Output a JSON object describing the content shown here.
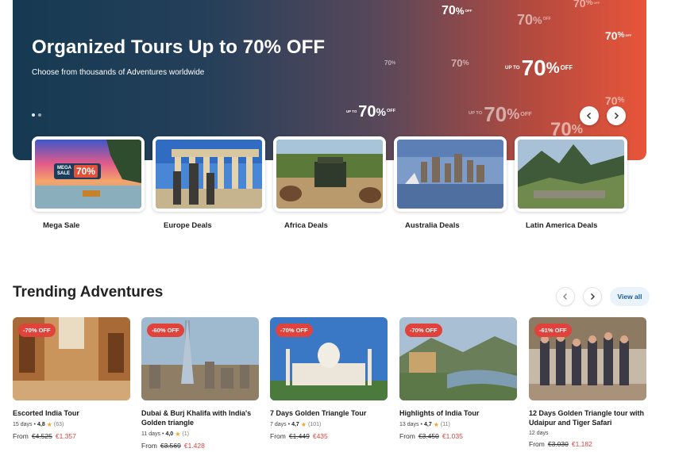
{
  "hero": {
    "title": "Organized Tours Up to 70% OFF",
    "subtitle": "Choose from thousands of Adventures worldwide",
    "promo_value": "70",
    "promo_percent": "%",
    "promo_off": "OFF",
    "promo_upto": "UP TO",
    "prev_icon": "chevron-left-icon",
    "next_icon": "chevron-right-icon",
    "slides_count": 2,
    "active_slide": 1
  },
  "deals": [
    {
      "label": "Mega Sale",
      "overlay": {
        "mega": "MEGA",
        "sale": "SALE",
        "value": "70%",
        "upto": "UP TO"
      }
    },
    {
      "label": "Europe Deals"
    },
    {
      "label": "Africa Deals"
    },
    {
      "label": "Australia Deals"
    },
    {
      "label": "Latin America Deals"
    }
  ],
  "trending": {
    "title": "Trending Adventures",
    "view_all": "View all",
    "prev_icon": "chevron-left-icon",
    "next_icon": "chevron-right-icon",
    "tours": [
      {
        "badge": "-70% OFF",
        "title": "Escorted India Tour",
        "days": "15 days",
        "rating": "4,8",
        "reviews": "(63)",
        "from": "From",
        "old_price": "€4.525",
        "new_price": "€1.357"
      },
      {
        "badge": "-60% OFF",
        "title": "Dubai & Burj Khalifa with India's Golden triangle",
        "days": "11 days",
        "rating": "4,0",
        "reviews": "(1)",
        "from": "From",
        "old_price": "€3.569",
        "new_price": "€1.428"
      },
      {
        "badge": "-70% OFF",
        "title": "7 Days Golden Triangle Tour",
        "days": "7 days",
        "rating": "4,7",
        "reviews": "(101)",
        "from": "From",
        "old_price": "€1.449",
        "new_price": "€435"
      },
      {
        "badge": "-70% OFF",
        "title": "Highlights of India Tour",
        "days": "13 days",
        "rating": "4,7",
        "reviews": "(11)",
        "from": "From",
        "old_price": "€3.450",
        "new_price": "€1.035"
      },
      {
        "badge": "-61% OFF",
        "title": "12 Days Golden Triangle tour with Udaipur and Tiger Safari",
        "days": "12 days",
        "rating": "",
        "reviews": "",
        "from": "From",
        "old_price": "€3.030",
        "new_price": "€1.182"
      }
    ]
  },
  "colors": {
    "accent_red": "#e0423c",
    "hero_left": "#163a52",
    "hero_right": "#e8553a",
    "link_blue": "#1a5a9a",
    "star": "#f2a41c"
  }
}
